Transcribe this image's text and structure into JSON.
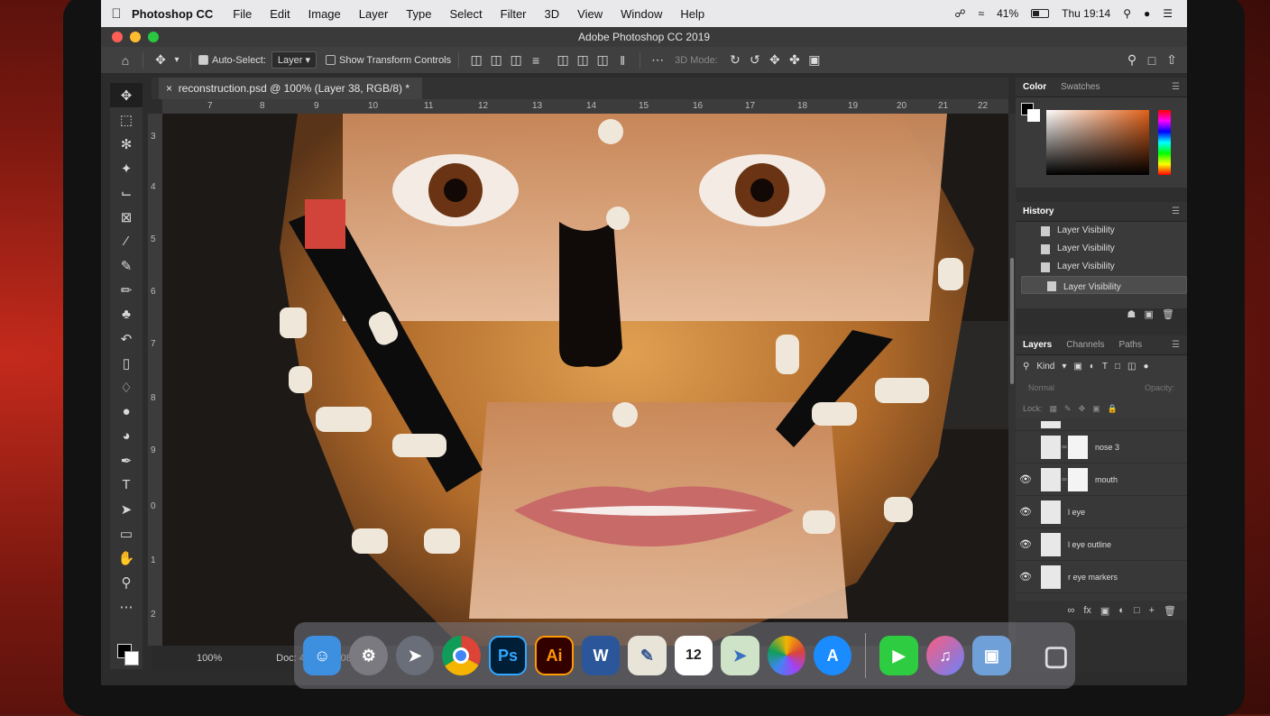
{
  "menubar": {
    "apple_icon": "apple-icon",
    "app_name": "Photoshop CC",
    "items": [
      "File",
      "Edit",
      "Image",
      "Layer",
      "Type",
      "Select",
      "Filter",
      "3D",
      "View",
      "Window",
      "Help"
    ],
    "battery": "41%",
    "clock": "Thu 19:14"
  },
  "window": {
    "title": "Adobe Photoshop CC 2019"
  },
  "options": {
    "auto_select_label": "Auto-Select:",
    "auto_select_value": "Layer",
    "show_transform_label": "Show Transform Controls",
    "mode_3d": "3D Mode:"
  },
  "document": {
    "tab_title": "reconstruction.psd @ 100% (Layer 38, RGB/8) *",
    "ruler_h": [
      "7",
      "8",
      "9",
      "10",
      "11",
      "12",
      "13",
      "14",
      "15",
      "16",
      "17",
      "18",
      "19",
      "20",
      "21",
      "22"
    ],
    "ruler_v": [
      "3",
      "4",
      "5",
      "6",
      "7",
      "8",
      "9",
      "0",
      "1",
      "2"
    ],
    "zoom": "100%",
    "doc_size": "Doc: 44.0M/1008.3M"
  },
  "panels": {
    "color_tab": "Color",
    "swatches_tab": "Swatches",
    "history_title": "History",
    "history_items": [
      "Layer Visibility",
      "Layer Visibility",
      "Layer Visibility",
      "Layer Visibility"
    ],
    "layers_tab": "Layers",
    "channels_tab": "Channels",
    "paths_tab": "Paths",
    "kind_filter": "Kind",
    "blend_mode": "Normal",
    "opacity_label": "Opacity:",
    "lock_label": "Lock:",
    "layers": [
      {
        "name": "nose 3",
        "visible": false,
        "mask": true
      },
      {
        "name": "mouth",
        "visible": true,
        "mask": true
      },
      {
        "name": "l eye",
        "visible": true,
        "mask": false
      },
      {
        "name": "l eye outline",
        "visible": true,
        "mask": false
      },
      {
        "name": "r eye markers",
        "visible": true,
        "mask": false
      }
    ]
  },
  "dock": {
    "apps": [
      "Finder",
      "System Preferences",
      "Launchpad",
      "Chrome",
      "Ps",
      "Ai",
      "W",
      "Preview",
      "12",
      "Maps",
      "Photos",
      "App Store",
      "FaceTime",
      "Music",
      "Image Capture",
      "Trash"
    ]
  },
  "colors": {
    "accent": "#31a8ff",
    "panel": "#3a3a3a",
    "skin": "#d9a06a"
  }
}
